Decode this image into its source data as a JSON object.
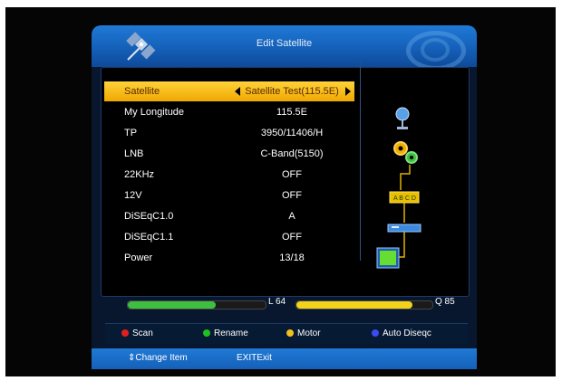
{
  "header": {
    "title": "Edit Satellite"
  },
  "menu": [
    {
      "label": "Satellite",
      "value": "Satellite Test(115.5E)",
      "selected": true
    },
    {
      "label": "My Longitude",
      "value": "115.5E"
    },
    {
      "label": "TP",
      "value": "3950/11406/H"
    },
    {
      "label": "LNB",
      "value": "C-Band(5150)"
    },
    {
      "label": "22KHz",
      "value": "OFF"
    },
    {
      "label": "12V",
      "value": "OFF"
    },
    {
      "label": "DiSEqC1.0",
      "value": "A"
    },
    {
      "label": "DiSEqC1.1",
      "value": "OFF"
    },
    {
      "label": "Power",
      "value": "13/18"
    }
  ],
  "signal": {
    "level_label": "L 64",
    "level": 0.64,
    "level_color": "#3fbf3f",
    "quality_label": "Q 85",
    "quality": 0.85,
    "quality_color": "#f2d21a"
  },
  "color_keys": [
    {
      "label": "Scan",
      "color": "#e02020"
    },
    {
      "label": "Rename",
      "color": "#20c020"
    },
    {
      "label": "Motor",
      "color": "#f0c020"
    },
    {
      "label": "Auto Diseqc",
      "color": "#3a4cf0"
    }
  ],
  "footer": {
    "change_item": "Change Item",
    "exit": "EXITExit"
  },
  "diagram_icons": [
    "satellite-dish-icon",
    "gears-icon",
    "switch-abcd-icon",
    "receiver-icon",
    "tv-icon"
  ]
}
